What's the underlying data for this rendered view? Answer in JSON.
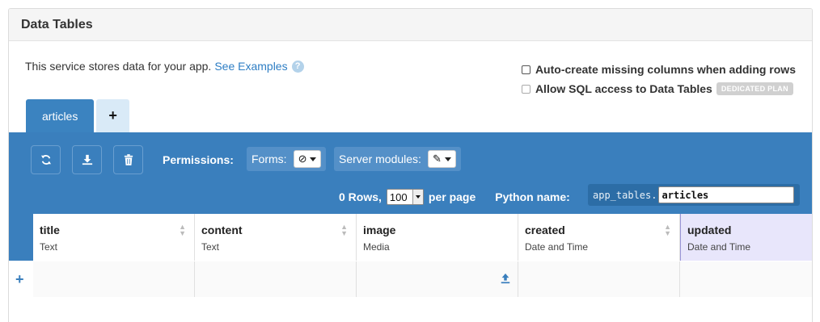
{
  "panel": {
    "title": "Data Tables"
  },
  "intro": {
    "text": "This service stores data for your app.",
    "link": "See Examples",
    "help": "?"
  },
  "options": {
    "auto_create": "Auto-create missing columns when adding rows",
    "sql_access": "Allow SQL access to Data Tables",
    "sql_badge": "DEDICATED PLAN"
  },
  "tabs": [
    {
      "label": "articles",
      "active": true
    }
  ],
  "add_tab_label": "+",
  "toolbar": {
    "permissions_label": "Permissions:",
    "forms_label": "Forms:",
    "forms_value": "⊘",
    "server_label": "Server modules:",
    "server_value": "✎",
    "rows_label": "0 Rows,",
    "per_page_value": "100",
    "per_page_label": "per page",
    "python_label": "Python name:",
    "python_prefix": "app_tables.",
    "python_name": "articles"
  },
  "columns": [
    {
      "name": "title",
      "type": "Text"
    },
    {
      "name": "content",
      "type": "Text"
    },
    {
      "name": "image",
      "type": "Media"
    },
    {
      "name": "created",
      "type": "Date and Time"
    },
    {
      "name": "updated",
      "type": "Date and Time"
    }
  ],
  "add_row_label": "+",
  "colors": {
    "toolbar": "#3a7fbd",
    "link": "#2e7ec4",
    "selected_column": "#e8e6fb"
  }
}
